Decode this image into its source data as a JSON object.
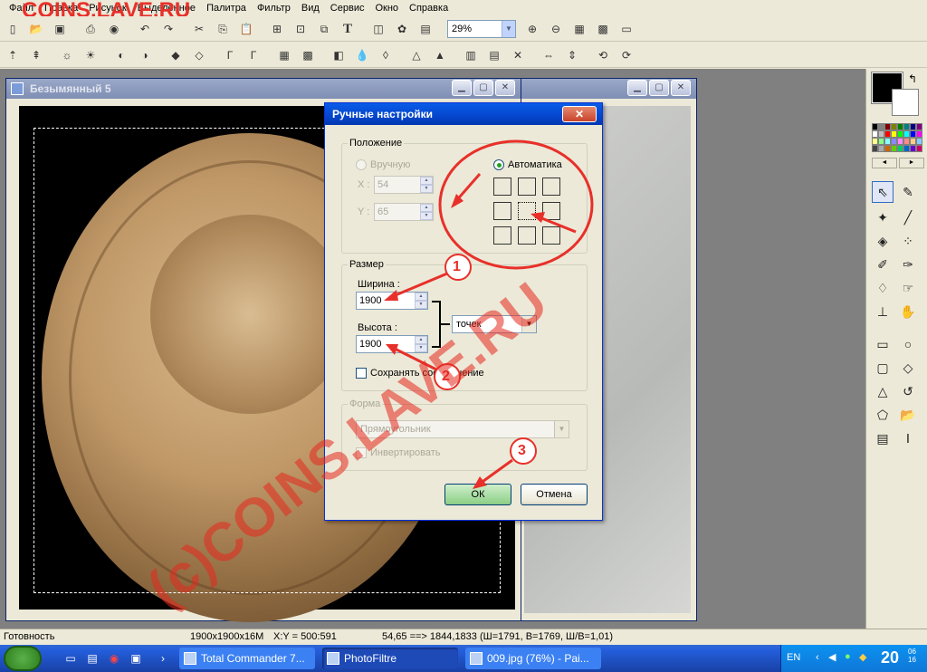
{
  "watermark": {
    "top": "COINS.LAVE.RU",
    "diagonal": "(c)COINS.LAVE.RU"
  },
  "menubar": [
    "Файл",
    "Правка",
    "Рисунок",
    "Выделенное",
    "Палитра",
    "Фильтр",
    "Вид",
    "Сервис",
    "Окно",
    "Справка"
  ],
  "toolbar": {
    "zoom": "29%"
  },
  "image_window": {
    "title": "Безымянный 5"
  },
  "dialog": {
    "title": "Ручные настройки",
    "position": {
      "legend": "Положение",
      "manual_label": "Вручную",
      "auto_label": "Автоматика",
      "x_label": "X :",
      "x_value": "54",
      "y_label": "Y :",
      "y_value": "65"
    },
    "size": {
      "legend": "Размер",
      "width_label": "Ширина :",
      "width_value": "1900",
      "height_label": "Высота :",
      "height_value": "1900",
      "unit": "точек",
      "keep_ratio": "Сохранять соотношение"
    },
    "shape": {
      "legend": "Форма",
      "value": "Прямоугольник",
      "invert": "Инвертировать"
    },
    "ok": "ОК",
    "cancel": "Отмена"
  },
  "annotations": {
    "n1": "1",
    "n2": "2",
    "n3": "3"
  },
  "statusbar": {
    "ready": "Готовность",
    "size": "1900x1900x16M",
    "coords": "X:Y = 500:591",
    "selection": "54,65 ==> 1844,1833 (Ш=1791, В=1769, Ш/В=1,01)"
  },
  "taskbar": {
    "tasks": [
      "Total Commander 7...",
      "PhotoFiltre",
      "009.jpg (76%) - Pai..."
    ],
    "lang": "EN",
    "clock": "20",
    "clock_small": "06\n16"
  },
  "colors": {
    "accent_red": "#e8302a",
    "dialog_title": "#0446cc"
  }
}
